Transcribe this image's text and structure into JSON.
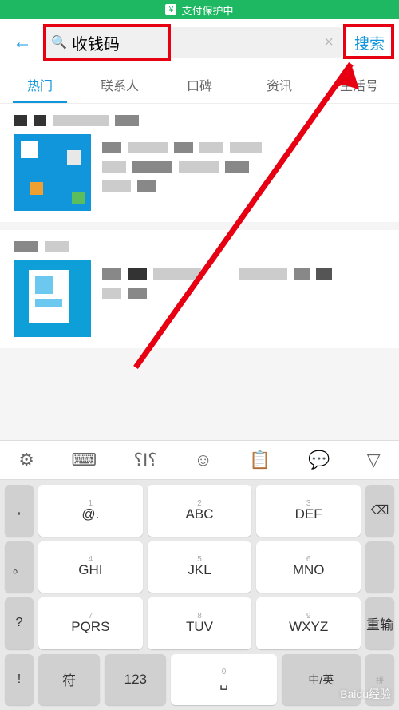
{
  "status_bar": {
    "text": "支付保护中"
  },
  "search": {
    "value": "收钱码",
    "button": "搜索"
  },
  "tabs": [
    "热门",
    "联系人",
    "口碑",
    "资讯",
    "生活号"
  ],
  "active_tab": 0,
  "toolbar": {
    "icons": [
      "gear",
      "keyboard",
      "cursor",
      "smile",
      "clipboard",
      "comment",
      "chevron-down"
    ]
  },
  "keyboard": {
    "side_left": [
      ",",
      "。",
      "?",
      "!"
    ],
    "rows": [
      [
        {
          "n": "1",
          "l": "@."
        },
        {
          "n": "2",
          "l": "ABC"
        },
        {
          "n": "3",
          "l": "DEF"
        }
      ],
      [
        {
          "n": "4",
          "l": "GHI"
        },
        {
          "n": "5",
          "l": "JKL"
        },
        {
          "n": "6",
          "l": "MNO"
        }
      ],
      [
        {
          "n": "7",
          "l": "PQRS"
        },
        {
          "n": "8",
          "l": "TUV"
        },
        {
          "n": "9",
          "l": "WXYZ"
        }
      ]
    ],
    "side_right": [
      "⌫",
      "",
      "重输"
    ],
    "bottom": {
      "l": "符",
      "mid_l": "123",
      "mid_n": "0",
      "mid_r": "中/英",
      "r_tag": "拼"
    }
  },
  "watermark": "Baidu经验"
}
